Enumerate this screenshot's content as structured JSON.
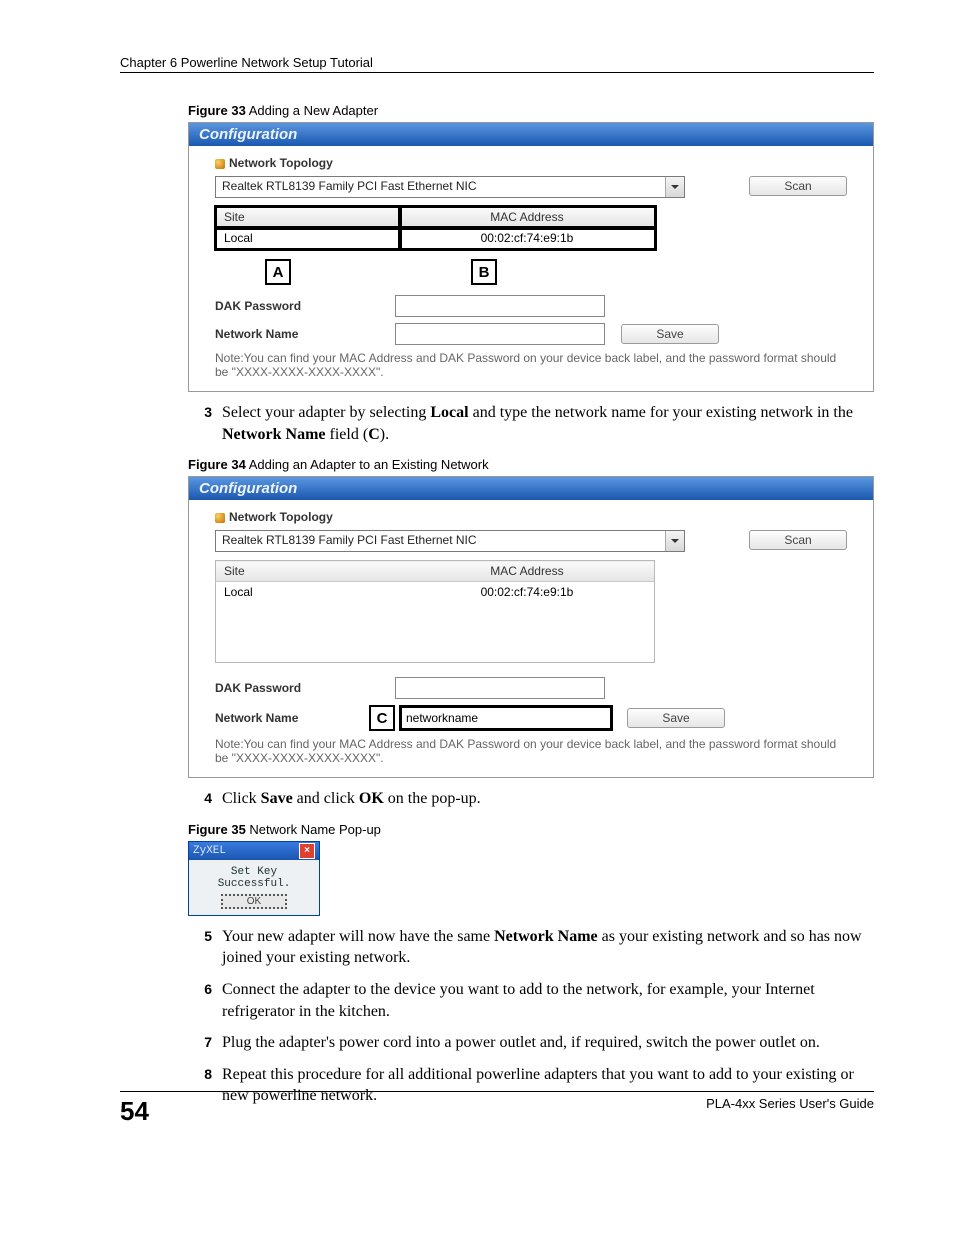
{
  "header": {
    "chapter": "Chapter 6 Powerline Network Setup Tutorial"
  },
  "fig33": {
    "caption_bold": "Figure 33",
    "caption_rest": "   Adding a New Adapter",
    "titlebar": "Configuration",
    "section": "Network Topology",
    "nic": "Realtek RTL8139 Family PCI Fast Ethernet NIC",
    "cols": {
      "site": "Site",
      "mac": "MAC Address"
    },
    "row": {
      "site": "Local",
      "mac": "00:02:cf:74:e9:1b"
    },
    "scan": "Scan",
    "markerA": "A",
    "markerB": "B",
    "dak_label": "DAK Password",
    "dak_value": "",
    "net_label": "Network Name",
    "net_value": "",
    "save": "Save",
    "note": "Note:You can find your MAC Address and DAK Password on your device back label, and the password format should be \"XXXX-XXXX-XXXX-XXXX\"."
  },
  "step3": {
    "num": "3",
    "text_before": "Select your adapter by selecting ",
    "b1": "Local",
    "text_mid": " and type the network name for your existing network in the ",
    "b2": "Network Name",
    "text_after": " field (",
    "b3": "C",
    "text_end": ")."
  },
  "fig34": {
    "caption_bold": "Figure 34",
    "caption_rest": "   Adding an Adapter to an Existing Network",
    "titlebar": "Configuration",
    "section": "Network Topology",
    "nic": "Realtek RTL8139 Family PCI Fast Ethernet NIC",
    "cols": {
      "site": "Site",
      "mac": "MAC Address"
    },
    "row": {
      "site": "Local",
      "mac": "00:02:cf:74:e9:1b"
    },
    "scan": "Scan",
    "dak_label": "DAK Password",
    "dak_value": "",
    "markerC": "C",
    "net_label": "Network Name",
    "net_value": "networkname",
    "save": "Save",
    "note": "Note:You can find your MAC Address and DAK Password on your device back label, and the password format should be \"XXXX-XXXX-XXXX-XXXX\"."
  },
  "step4": {
    "num": "4",
    "t1": "Click ",
    "b1": "Save",
    "t2": " and click ",
    "b2": "OK",
    "t3": " on the pop-up."
  },
  "fig35": {
    "caption_bold": "Figure 35",
    "caption_rest": "   Network Name Pop-up",
    "brand": "ZyXEL",
    "msg": "Set Key Successful.",
    "ok": "OK"
  },
  "step5": {
    "num": "5",
    "t1": "Your new adapter will now have the same ",
    "b1": "Network Name",
    "t2": " as your existing network and so has now joined your existing network."
  },
  "step6": {
    "num": "6",
    "t1": "Connect the adapter to the device you want to add to the network, for example, your Internet refrigerator in the kitchen."
  },
  "step7": {
    "num": "7",
    "t1": "Plug the adapter's power cord into a power outlet and, if required, switch the power outlet on."
  },
  "step8": {
    "num": "8",
    "t1": "Repeat this procedure for all additional powerline adapters that you want to add to your existing or new powerline network."
  },
  "footer": {
    "page": "54",
    "guide": "PLA-4xx Series User's Guide"
  }
}
